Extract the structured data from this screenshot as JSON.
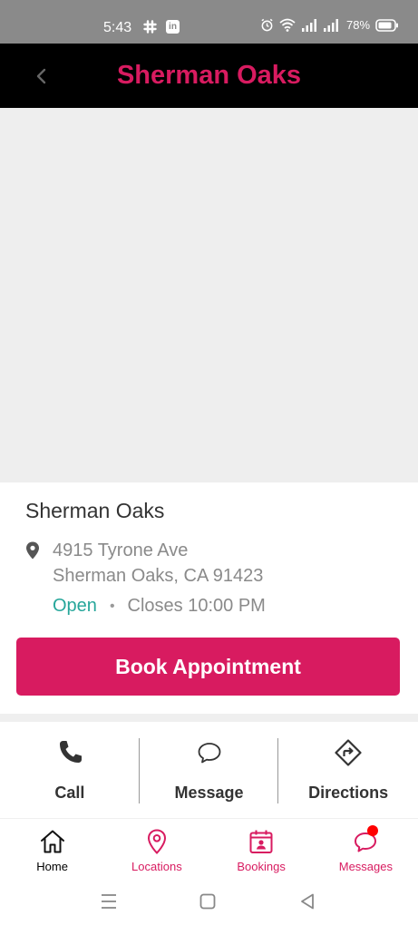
{
  "status_bar": {
    "time": "5:43",
    "battery": "78%",
    "linkedin_glyph": "in"
  },
  "header": {
    "title": "Sherman Oaks"
  },
  "location": {
    "name": "Sherman Oaks",
    "address_line1": "4915 Tyrone Ave",
    "address_line2": "Sherman Oaks, CA 91423",
    "status": "Open",
    "separator": "•",
    "closes": "Closes 10:00 PM"
  },
  "book_button": {
    "label": "Book Appointment"
  },
  "actions": [
    {
      "label": "Call",
      "icon": "phone-icon"
    },
    {
      "label": "Message",
      "icon": "chat-bubble-icon"
    },
    {
      "label": "Directions",
      "icon": "directions-icon"
    }
  ],
  "bottom_nav": [
    {
      "label": "Home",
      "icon": "home-icon",
      "active": true
    },
    {
      "label": "Locations",
      "icon": "map-pin-icon",
      "active": false
    },
    {
      "label": "Bookings",
      "icon": "calendar-icon",
      "active": false
    },
    {
      "label": "Messages",
      "icon": "chat-icon",
      "active": false,
      "badge": true
    }
  ],
  "colors": {
    "accent": "#d81b60",
    "open": "#26a69a",
    "header_bg": "#000000",
    "status_bar_bg": "#8a8a8a",
    "map_bg": "#eeeeee",
    "badge": "#ff0000"
  }
}
